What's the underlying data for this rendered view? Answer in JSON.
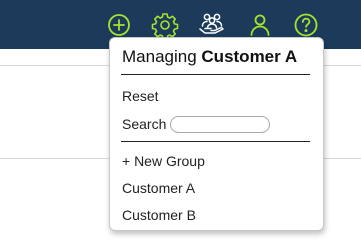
{
  "header": {
    "icons": [
      {
        "name": "add-circle-icon"
      },
      {
        "name": "gear-icon"
      },
      {
        "name": "people-in-hand-icon"
      },
      {
        "name": "user-icon"
      },
      {
        "name": "help-circle-icon"
      }
    ],
    "icon_color": "#a6e22e",
    "background_color": "#1c3b5b"
  },
  "dropdown": {
    "title_prefix": "Managing",
    "title_customer": "Customer A",
    "reset_label": "Reset",
    "search_label": "Search",
    "search_value": "",
    "new_group_label": "+ New Group",
    "customers": [
      "Customer A",
      "Customer B"
    ]
  }
}
